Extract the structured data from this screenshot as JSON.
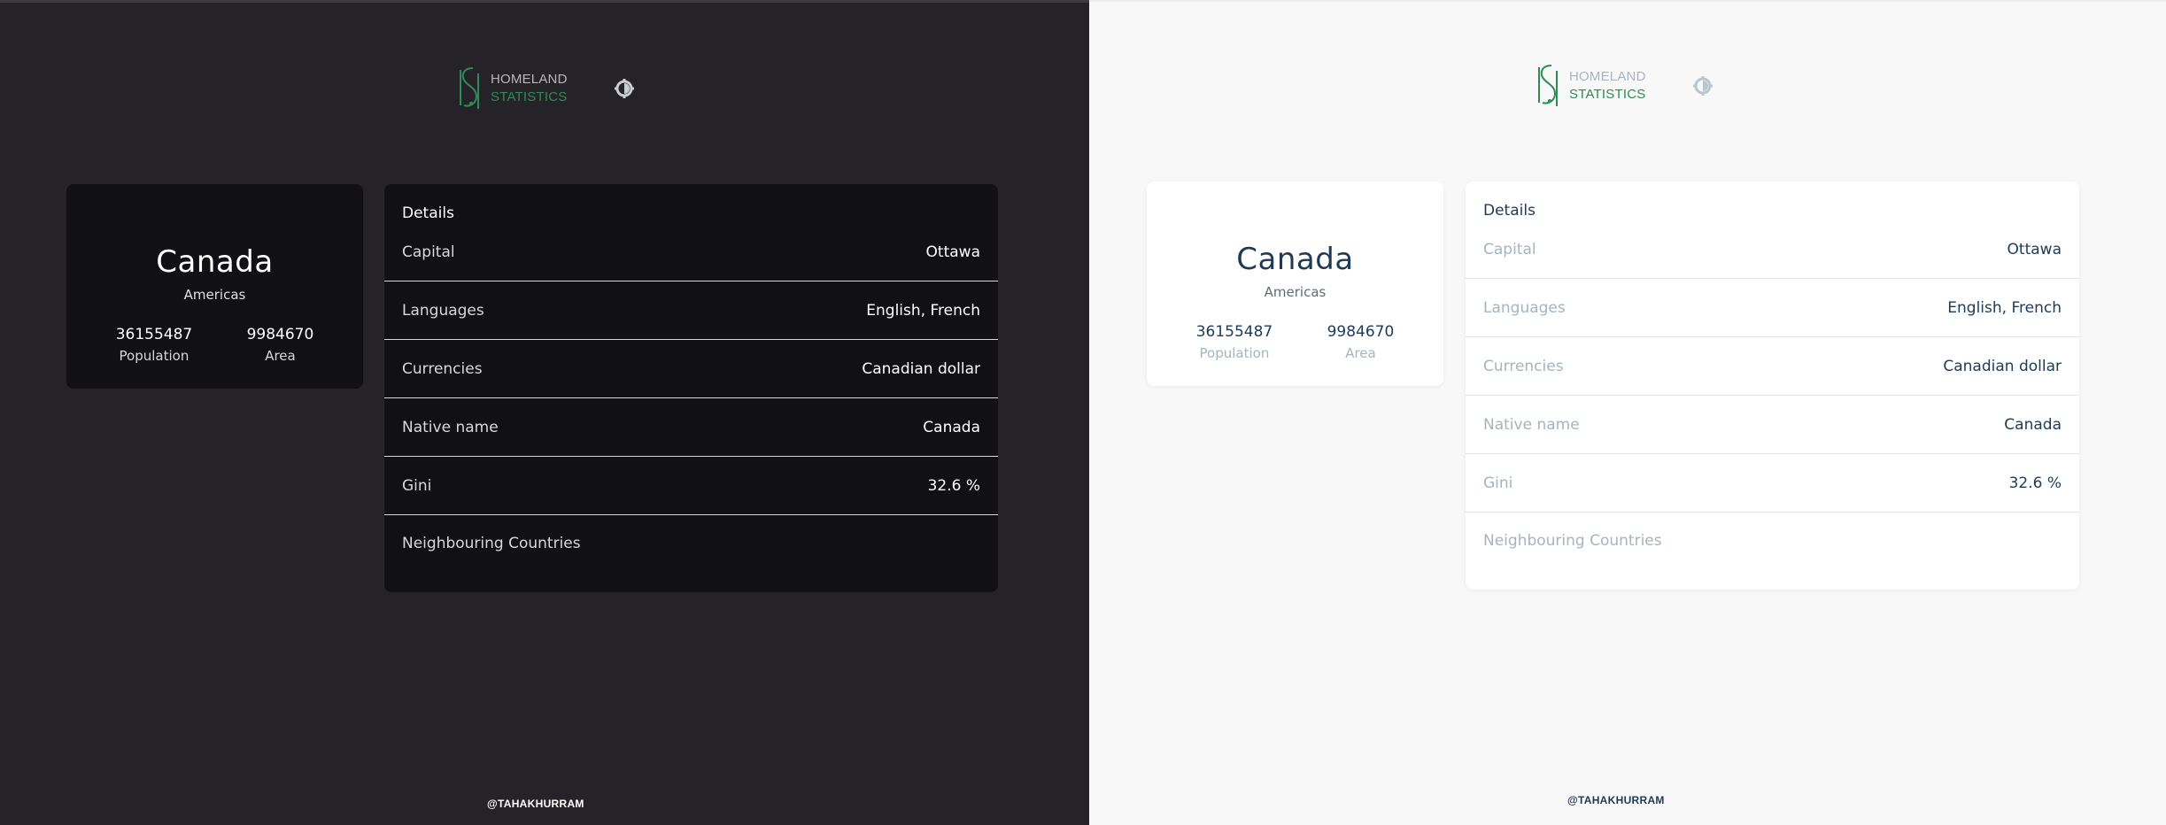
{
  "panels": [
    {
      "theme": "dark",
      "brand": {
        "line1": "HOMELAND",
        "line2": "STATISTICS",
        "accent": "#2e8b57"
      },
      "theme_toggle_icon": "contrast-icon",
      "country": {
        "name": "Canada",
        "region": "Americas",
        "population": "36155487",
        "population_label": "Population",
        "area": "9984670",
        "area_label": "Area"
      },
      "details": {
        "title": "Details",
        "rows": [
          {
            "label": "Capital",
            "value": "Ottawa"
          },
          {
            "label": "Languages",
            "value": "English, French"
          },
          {
            "label": "Currencies",
            "value": "Canadian dollar"
          },
          {
            "label": "Native name",
            "value": "Canada"
          },
          {
            "label": "Gini",
            "value": "32.6 %"
          }
        ],
        "neighbours_label": "Neighbouring Countries"
      },
      "footer": "@TAHAKHURRAM"
    },
    {
      "theme": "light",
      "brand": {
        "line1": "HOMELAND",
        "line2": "STATISTICS",
        "accent": "#2e8b57"
      },
      "theme_toggle_icon": "contrast-icon",
      "country": {
        "name": "Canada",
        "region": "Americas",
        "population": "36155487",
        "population_label": "Population",
        "area": "9984670",
        "area_label": "Area"
      },
      "details": {
        "title": "Details",
        "rows": [
          {
            "label": "Capital",
            "value": "Ottawa"
          },
          {
            "label": "Languages",
            "value": "English, French"
          },
          {
            "label": "Currencies",
            "value": "Canadian dollar"
          },
          {
            "label": "Native name",
            "value": "Canada"
          },
          {
            "label": "Gini",
            "value": "32.6 %"
          }
        ],
        "neighbours_label": "Neighbouring Countries"
      },
      "footer": "@TAHAKHURRAM"
    }
  ]
}
